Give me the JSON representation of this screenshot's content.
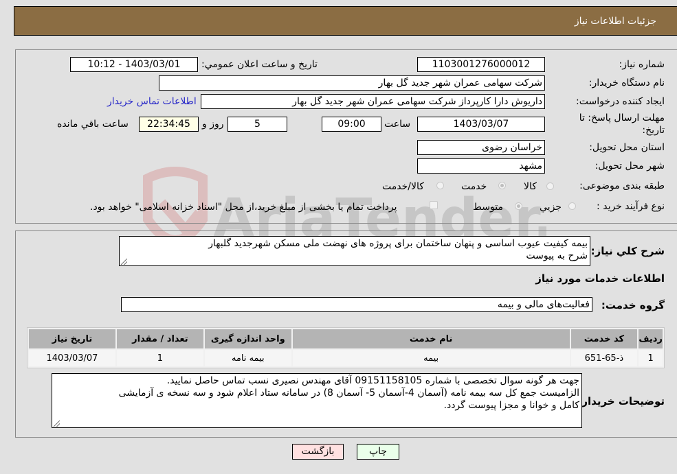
{
  "header": {
    "title": "جزئیات اطلاعات نیاز"
  },
  "form": {
    "need_number": {
      "label": "شماره نیاز:",
      "value": "1103001276000012"
    },
    "announce_datetime": {
      "label": "تاریخ و ساعت اعلان عمومي:",
      "value": "1403/03/01 - 10:12"
    },
    "buyer_org": {
      "label": "نام دستگاه خریدار:",
      "value": "شرکت سهامی عمران شهر جدید گل بهار"
    },
    "requester": {
      "label": "ایجاد کننده درخواست:",
      "value": "داریوش دارا کارپرداز شرکت سهامی عمران شهر جدید گل بهار"
    },
    "buyer_contact_link": "اطلاعات تماس خریدار",
    "deadline": {
      "label_line1": "مهلت ارسال پاسخ: تا",
      "label_line2": "تاریخ:",
      "date": "1403/03/07",
      "time_label": "ساعت",
      "time": "09:00",
      "days": "5",
      "days_label": "روز و",
      "remaining": "22:34:45",
      "remaining_label": "ساعت باقي مانده"
    },
    "province": {
      "label": "استان محل تحویل:",
      "value": "خراسان رضوی"
    },
    "city": {
      "label": "شهر محل تحویل:",
      "value": "مشهد"
    },
    "category": {
      "label": "طبقه بندی موضوعی:",
      "options": [
        "کالا",
        "خدمت",
        "کالا/خدمت"
      ],
      "selected": "خدمت"
    },
    "purchase_type": {
      "label": "نوع فرآیند خرید :",
      "options": [
        "جزیي",
        "متوسط"
      ],
      "selected": "متوسط",
      "treasury_note": "پرداخت تمام یا بخشی از مبلغ خرید،از محل \"اسناد خزانه اسلامی\" خواهد بود."
    }
  },
  "details": {
    "summary_label": "شرح کلي نیاز:",
    "summary_line1": "بیمه کیفیت عیوب اساسی و پنهان ساختمان برای پروژه های نهضت ملی مسکن شهرجدید گلبهار",
    "summary_line2": "شرح به پیوست",
    "services_heading": "اطلاعات خدمات مورد نیاز",
    "service_group_label": "گروه خدمت:",
    "service_group_value": "فعالیت‌های مالی و بیمه",
    "table": {
      "headers": [
        "ردیف",
        "کد خدمت",
        "نام خدمت",
        "واحد اندازه گیری",
        "تعداد / مقدار",
        "تاریخ نیاز"
      ],
      "rows": [
        [
          "1",
          "ذ-65-651",
          "بیمه",
          "بیمه نامه",
          "1",
          "1403/03/07"
        ]
      ]
    },
    "buyer_notes_label": "توضیحات خریدار:",
    "buyer_notes_line1": "جهت هر گونه سوال تخصصی با شماره 09151158105 آقای مهندس نصیری نسب تماس حاصل نمایید.",
    "buyer_notes_line2": "الزامیست جمع کل سه بیمه نامه (آسمان 4-آسمان 5- آسمان 8) در سامانه ستاد اعلام شود و سه نسخه ی آزمایشی",
    "buyer_notes_line3": "کامل و خوانا و مجزا پیوست گردد."
  },
  "buttons": {
    "back": "بازگشت",
    "print": "چاپ"
  },
  "watermark": {
    "text": "AriaTender.neT"
  }
}
